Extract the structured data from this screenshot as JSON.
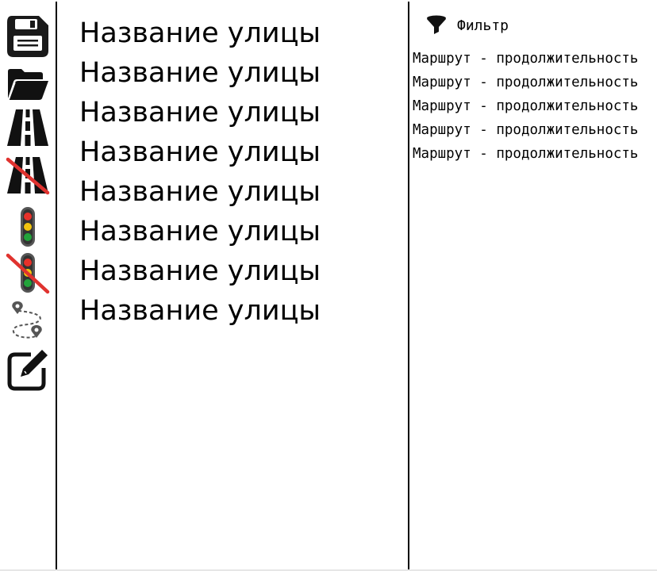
{
  "toolbar": {
    "tools": [
      {
        "icon": "save-icon"
      },
      {
        "icon": "open-folder-icon"
      },
      {
        "icon": "road-icon"
      },
      {
        "icon": "road-off-icon"
      },
      {
        "icon": "traffic-light-icon"
      },
      {
        "icon": "traffic-light-off-icon"
      },
      {
        "icon": "route-icon"
      },
      {
        "icon": "edit-icon"
      }
    ]
  },
  "streets": [
    "Название улицы",
    "Название улицы",
    "Название улицы",
    "Название улицы",
    "Название улицы",
    "Название улицы",
    "Название улицы",
    "Название улицы"
  ],
  "filter": {
    "label": "Фильтр",
    "icon": "filter-icon"
  },
  "routes": [
    "Маршрут - продолжительность",
    "Маршрут - продолжительность",
    "Маршрут - продолжительность",
    "Маршрут - продолжительность",
    "Маршрут - продолжительность"
  ],
  "colors": {
    "strike_red": "#e0332f",
    "light_red": "#e8312a",
    "light_yellow": "#f2c40f",
    "light_green": "#22a33a",
    "icon_gray": "#555555"
  }
}
